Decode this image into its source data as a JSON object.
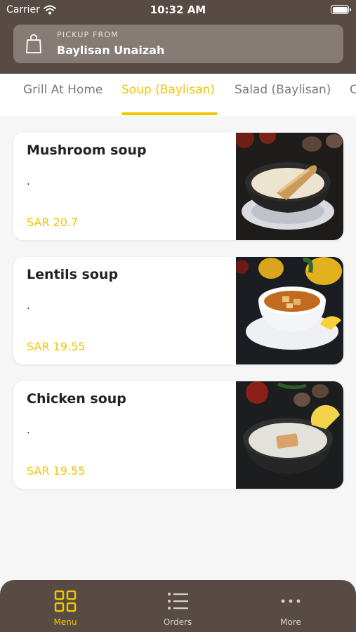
{
  "status_bar": {
    "carrier": "Carrier",
    "time": "10:32 AM"
  },
  "pickup": {
    "label": "PICKUP FROM",
    "location": "Baylisan Unaizah"
  },
  "tabs": [
    {
      "label": "Grill At Home",
      "active": false
    },
    {
      "label": "Soup (Baylisan)",
      "active": true
    },
    {
      "label": "Salad (Baylisan)",
      "active": false
    },
    {
      "label": "C",
      "active": false
    }
  ],
  "items": [
    {
      "name": "Mushroom soup",
      "description": ".",
      "price": "SAR 20.7",
      "image": "mushroom-soup-photo"
    },
    {
      "name": "Lentils soup",
      "description": ".",
      "price": "SAR 19.55",
      "image": "lentils-soup-photo"
    },
    {
      "name": "Chicken soup",
      "description": ".",
      "price": "SAR 19.55",
      "image": "chicken-soup-photo"
    }
  ],
  "bottom_nav": [
    {
      "label": "Menu",
      "icon": "grid-icon",
      "active": true
    },
    {
      "label": "Orders",
      "icon": "list-icon",
      "active": false
    },
    {
      "label": "More",
      "icon": "more-dots-icon",
      "active": false
    }
  ],
  "colors": {
    "header": "#574b44",
    "accent": "#f2c500",
    "pickup_box": "#867b75"
  }
}
